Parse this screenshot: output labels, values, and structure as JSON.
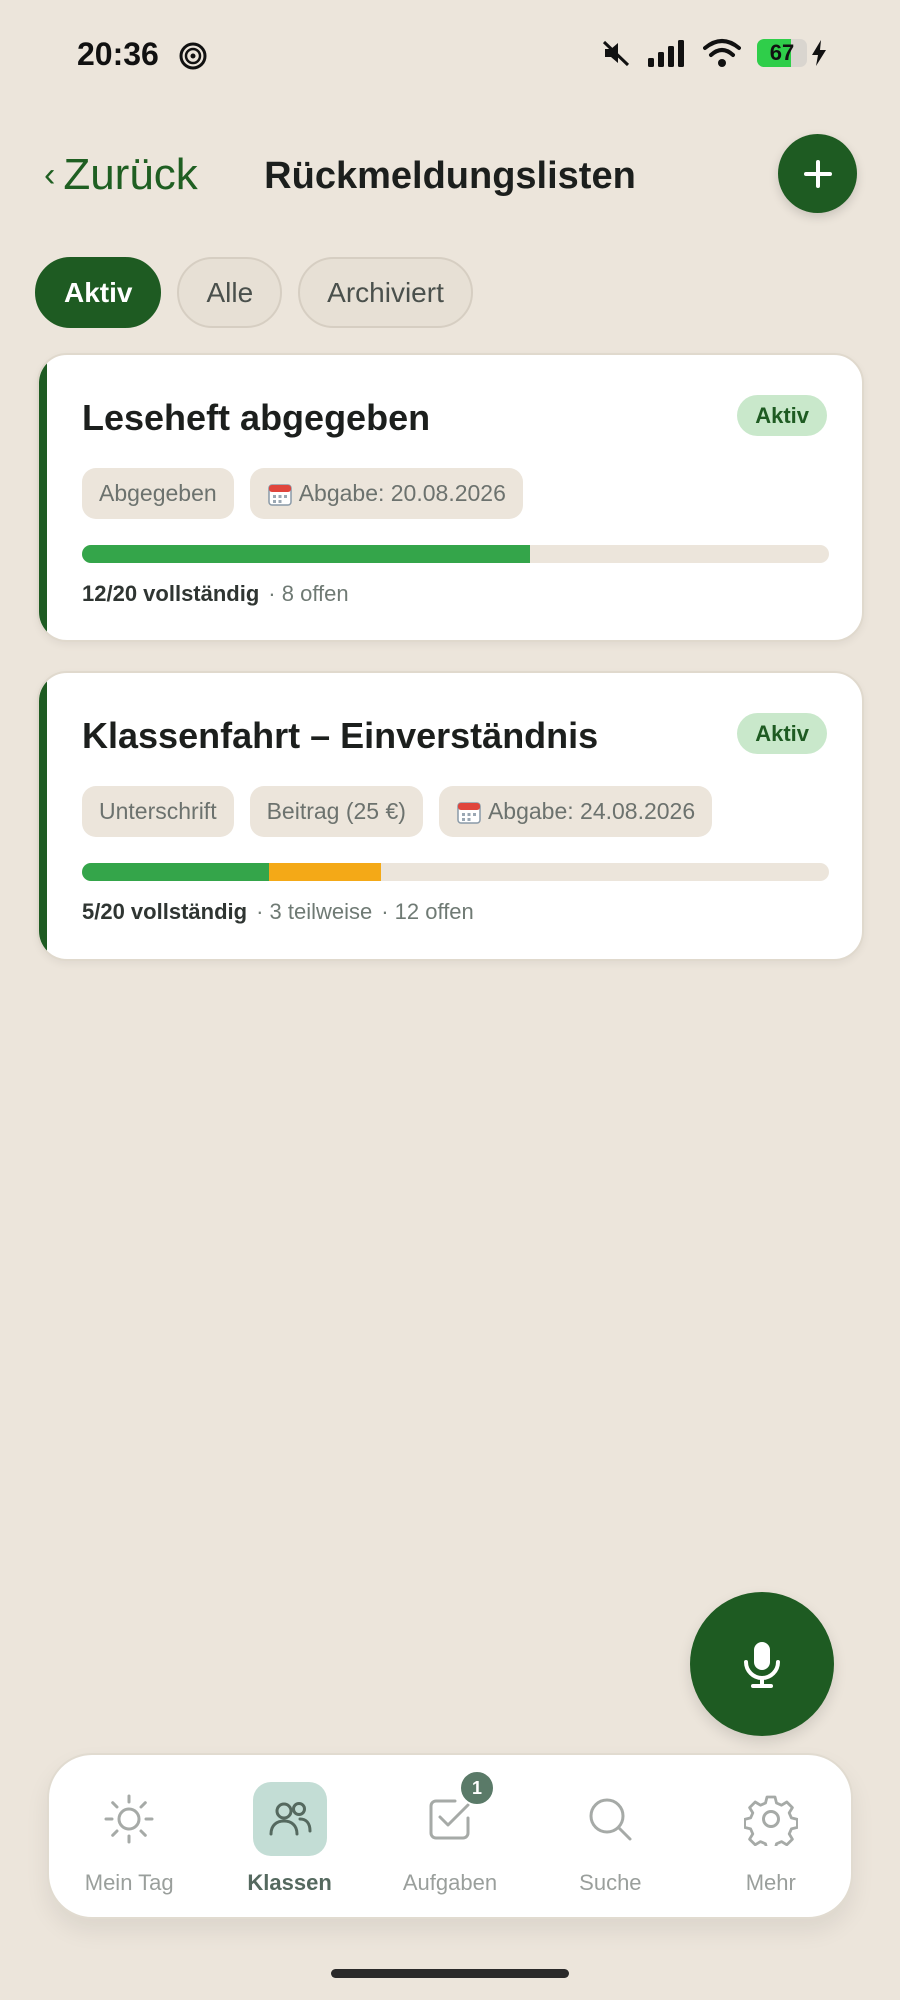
{
  "status_bar": {
    "time": "20:36",
    "battery_level": "67",
    "icons": [
      "focus-icon",
      "mute-icon",
      "signal-icon",
      "wifi-icon",
      "battery-icon",
      "charging-icon"
    ]
  },
  "header": {
    "back_chevron": "‹",
    "back_label": "Zurück",
    "title": "Rückmeldungslisten",
    "add_icon": "plus-icon"
  },
  "filters": [
    {
      "label": "Aktiv",
      "active": true
    },
    {
      "label": "Alle",
      "active": false
    },
    {
      "label": "Archiviert",
      "active": false
    }
  ],
  "cards": [
    {
      "title": "Leseheft abgegeben",
      "status": "Aktiv",
      "tags": [
        {
          "label": "Abgegeben",
          "icon": null
        },
        {
          "label": "Abgabe: 20.08.2026",
          "icon": "calendar-icon"
        }
      ],
      "progress": {
        "total": 20,
        "complete": 12,
        "partial": 0,
        "open": 8
      },
      "summary_strong": "12/20 vollständig",
      "summary_parts": [
        "· 8 offen"
      ]
    },
    {
      "title": "Klassenfahrt – Einverständnis",
      "status": "Aktiv",
      "tags": [
        {
          "label": "Unterschrift",
          "icon": null
        },
        {
          "label": "Beitrag (25 €)",
          "icon": null
        },
        {
          "label": "Abgabe: 24.08.2026",
          "icon": "calendar-icon"
        }
      ],
      "progress": {
        "total": 20,
        "complete": 5,
        "partial": 3,
        "open": 12
      },
      "summary_strong": "5/20 vollständig",
      "summary_parts": [
        "· 3 teilweise",
        "· 12 offen"
      ]
    }
  ],
  "mic_button": {
    "icon": "microphone-icon"
  },
  "bottom_nav": [
    {
      "label": "Mein Tag",
      "icon": "sun-icon",
      "active": false,
      "badge": null
    },
    {
      "label": "Klassen",
      "icon": "people-icon",
      "active": true,
      "badge": null
    },
    {
      "label": "Aufgaben",
      "icon": "checkbox-icon",
      "active": false,
      "badge": "1"
    },
    {
      "label": "Suche",
      "icon": "search-icon",
      "active": false,
      "badge": null
    },
    {
      "label": "Mehr",
      "icon": "gear-icon",
      "active": false,
      "badge": null
    }
  ],
  "colors": {
    "background": "#ece5db",
    "brand_green": "#1e5b22",
    "complete": "#34a54a",
    "partial": "#f4a917",
    "badge_bg": "#c9e8cb"
  }
}
